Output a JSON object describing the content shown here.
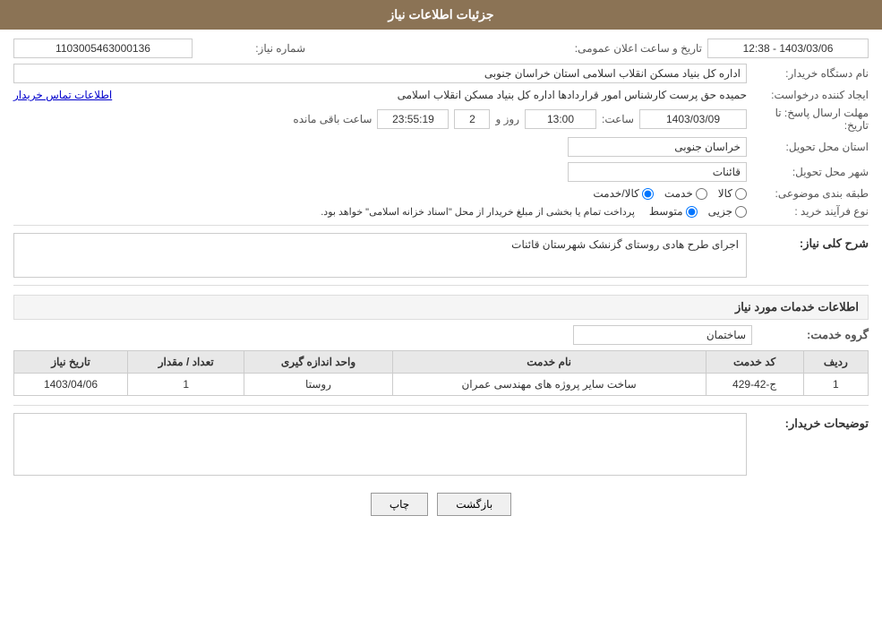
{
  "header": {
    "title": "جزئیات اطلاعات نیاز"
  },
  "fields": {
    "shomareNiaz_label": "شماره نیاز:",
    "shomareNiaz_value": "1103005463000136",
    "namDastgah_label": "نام دستگاه خریدار:",
    "namDastgah_value": "اداره کل بنیاد مسکن انقلاب اسلامی استان خراسان جنوبی",
    "ijadKonande_label": "ایجاد کننده درخواست:",
    "ijadKonande_value": "حمیده حق پرست کارشناس امور قراردادها اداره کل بنیاد مسکن انقلاب اسلامی",
    "ijadKonande_link": "اطلاعات تماس خریدار",
    "tarikhErsal_label": "مهلت ارسال پاسخ: تا تاریخ:",
    "tarikhErsal_date": "1403/03/09",
    "tarikhErsal_time_label": "ساعت:",
    "tarikhErsal_time": "13:00",
    "tarikhErsal_day_label": "روز و",
    "tarikhErsal_days": "2",
    "tarikhErsal_remain_label": "ساعت باقی مانده",
    "tarikhErsal_remain": "23:55:19",
    "ostan_label": "استان محل تحویل:",
    "ostan_value": "خراسان جنوبی",
    "shahr_label": "شهر محل تحویل:",
    "shahr_value": "قائنات",
    "tabaqe_label": "طبقه بندی موضوعی:",
    "tabaqe_kala": "کالا",
    "tabaqe_khadamat": "خدمت",
    "tabaqe_kala_khadamat": "کالا/خدمت",
    "noefarayand_label": "نوع فرآیند خرید :",
    "noefarayand_jozi": "جزیی",
    "noefarayand_motovaset": "متوسط",
    "noefarayand_notice": "پرداخت تمام یا بخشی از مبلغ خریدار از محل \"اسناد خزانه اسلامی\" خواهد بود.",
    "tarikhElan_label": "تاریخ و ساعت اعلان عمومی:",
    "tarikhElan_value": "1403/03/06 - 12:38",
    "sharh_label": "شرح کلی نیاز:",
    "sharh_value": "اجرای طرح هادی روستای گزنشک شهرستان قائنات",
    "khadamatInfo_title": "اطلاعات خدمات مورد نیاز",
    "garohKhadamat_label": "گروه خدمت:",
    "garohKhadamat_value": "ساختمان",
    "table": {
      "headers": [
        "ردیف",
        "کد خدمت",
        "نام خدمت",
        "واحد اندازه گیری",
        "تعداد / مقدار",
        "تاریخ نیاز"
      ],
      "rows": [
        {
          "radif": "1",
          "kodKhadamat": "ج-42-429",
          "namKhadamat": "ساخت سایر پروژه های مهندسی عمران",
          "vahed": "روستا",
          "tedadMegdar": "1",
          "tarikhNiaz": "1403/04/06"
        }
      ]
    },
    "tozihat_label": "توضیحات خریدار:",
    "tozihat_value": ""
  },
  "buttons": {
    "print": "چاپ",
    "back": "بازگشت"
  }
}
